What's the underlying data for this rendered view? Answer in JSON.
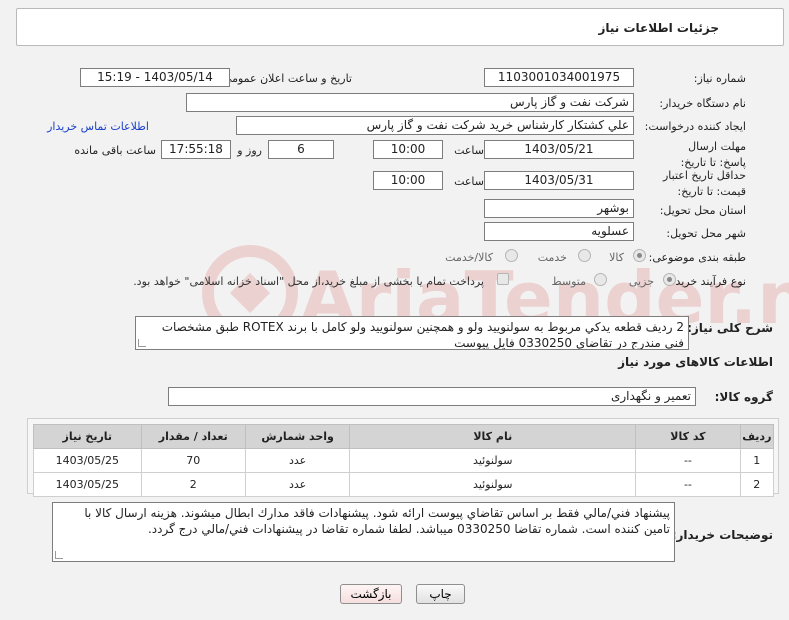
{
  "header": {
    "title": "جزئیات اطلاعات نیاز"
  },
  "need_number": {
    "label": "شماره نیاز:",
    "value": "1103001034001975"
  },
  "announce": {
    "label": "تاریخ و ساعت اعلان عمومی:",
    "value": "1403/05/14 - 15:19"
  },
  "buyer": {
    "label": "نام دستگاه خریدار:",
    "value": "شرکت نفت و گاز پارس"
  },
  "requester": {
    "label": "ایجاد کننده درخواست:",
    "value": "علي كشتكار كارشناس خريد شركت نفت و گاز پارس",
    "contact_link": "اطلاعات تماس خریدار"
  },
  "reply_deadline": {
    "label": "مهلت ارسال پاسخ: تا تاریخ:",
    "date": "1403/05/21",
    "time_label": "ساعت",
    "time": "10:00",
    "days": "6",
    "days_label": "روز و",
    "remaining": "17:55:18",
    "remaining_label": "ساعت باقی مانده"
  },
  "price_validity": {
    "label": "حداقل تاریخ اعتبار قیمت: تا تاریخ:",
    "date": "1403/05/31",
    "time_label": "ساعت",
    "time": "10:00"
  },
  "province": {
    "label": "استان محل تحویل:",
    "value": "بوشهر"
  },
  "city": {
    "label": "شهر محل تحویل:",
    "value": "عسلویه"
  },
  "category": {
    "label": "طبقه بندی موضوعی:",
    "options": [
      "کالا",
      "خدمت",
      "کالا/خدمت"
    ],
    "selected": "کالا"
  },
  "purchase_type": {
    "label": "نوع فرآیند خرید :",
    "options": [
      "جزیی",
      "متوسط"
    ],
    "selected": "جزیی",
    "note": "پرداخت تمام یا بخشی از مبلغ خرید،از محل \"اسناد خزانه اسلامی\" خواهد بود."
  },
  "description": {
    "label": "شرح کلی نیاز:",
    "value": "2 رديف قطعه يدكي مربوط به سولنوييد ولو و همچنين سولنوييد ولو كامل با برند ROTEX طبق مشخصات فني مندرج در تقاضاي 0330250 فايل پيوست"
  },
  "goods_info": {
    "title": "اطلاعات کالاهای مورد نیاز"
  },
  "goods_group": {
    "label": "گروه کالا:",
    "value": "تعمیر و نگهداری"
  },
  "table": {
    "headers": [
      "ردیف",
      "کد کالا",
      "نام کالا",
      "واحد شمارش",
      "تعداد / مقدار",
      "تاریخ نیاز"
    ],
    "rows": [
      [
        "1",
        "--",
        "سولنوئید",
        "عدد",
        "70",
        "1403/05/25"
      ],
      [
        "2",
        "--",
        "سولنوئید",
        "عدد",
        "2",
        "1403/05/25"
      ]
    ]
  },
  "buyer_notes": {
    "label": "توضیحات خریدار:",
    "value": "پيشنهاد فني/مالي فقط بر اساس تقاضاي پيوست ارائه شود. پيشنهادات فاقد مدارك ابطال ميشوند. هزينه ارسال كالا با تامين كننده است. شماره تقاضا 0330250 ميباشد. لطفا شماره تقاضا در پيشنهادات فني/مالي درج گردد."
  },
  "buttons": {
    "print": "چاپ",
    "back": "بازگشت"
  },
  "watermark": {
    "text": "AriaTender.net"
  }
}
